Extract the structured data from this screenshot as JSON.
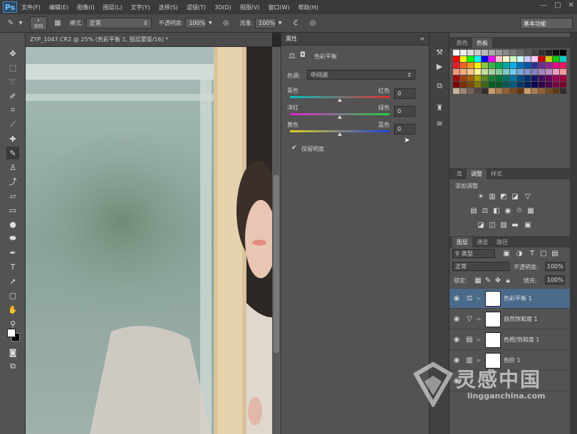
{
  "app": {
    "logo": "Ps"
  },
  "menu": [
    "文件(F)",
    "编辑(E)",
    "图像(I)",
    "图层(L)",
    "文字(Y)",
    "选择(S)",
    "滤镜(T)",
    "3D(D)",
    "视图(V)",
    "窗口(W)",
    "帮助(H)"
  ],
  "window_controls": [
    "—",
    "□",
    "✕"
  ],
  "options_bar": {
    "brush_size": "300",
    "mode_label": "模式:",
    "mode_value": "正常",
    "opacity_label": "不透明度:",
    "opacity_value": "100%",
    "flow_label": "流量:",
    "flow_value": "100%",
    "workspace": "基本功能"
  },
  "document": {
    "tab_title": "ZYP_1047.CR2 @ 25% (色彩平衡 1, 图层蒙版/16) *"
  },
  "properties": {
    "header": "属性",
    "title": "色彩平衡",
    "tone_label": "色调:",
    "tone_value": "中间调",
    "rows": [
      {
        "left": "青色",
        "right": "红色",
        "value": "0"
      },
      {
        "left": "洋红",
        "right": "绿色",
        "value": "0"
      },
      {
        "left": "黄色",
        "right": "蓝色",
        "value": "0"
      }
    ],
    "preserve_label": "保留明度"
  },
  "swatches": {
    "tab1": "颜色",
    "tab2": "色板"
  },
  "adjustments": {
    "tab1": "库",
    "tab2": "调整",
    "tab3": "样式",
    "title": "添加调整"
  },
  "layers": {
    "tab1": "图层",
    "tab2": "通道",
    "tab3": "路径",
    "filter": "类型",
    "blend": "正常",
    "opacity_label": "不透明度:",
    "opacity_value": "100%",
    "lock_label": "锁定:",
    "fill_label": "填充:",
    "fill_value": "100%",
    "items": [
      {
        "name": "色彩平衡 1",
        "icon": "⚖"
      },
      {
        "name": "自然饱和度 1",
        "icon": "▽"
      },
      {
        "name": "色相/饱和度 1",
        "icon": "▤"
      },
      {
        "name": "色阶 1",
        "icon": "▥"
      }
    ]
  },
  "watermark": {
    "title": "灵感中国",
    "url": "lingganchina.com"
  },
  "colors": {
    "accent": "#6bc0ff",
    "selected_layer": "#4a6a8a",
    "panel": "#535353"
  }
}
